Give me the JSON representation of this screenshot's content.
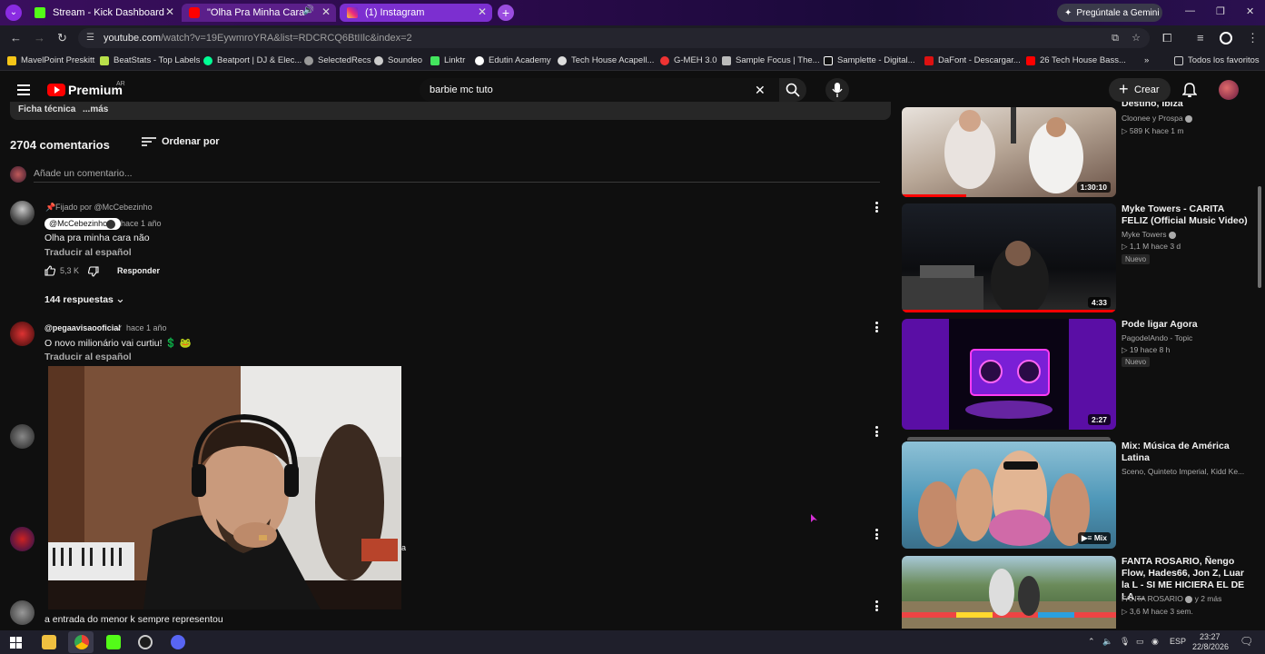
{
  "browser": {
    "tabs": [
      {
        "label": "Stream - Kick Dashboard"
      },
      {
        "label": "\"Olha Pra Minha Cara Não\""
      },
      {
        "label": "(1) Instagram"
      }
    ],
    "gemini_label": "Pregúntale a Gemini",
    "url_host": "youtube.com",
    "url_path": "/watch?v=19EywmroYRA&list=RDCRCQ6BtIIlc&index=2",
    "bookmarks": [
      "MavelPoint Preskitt",
      "BeatStats - Top Labels",
      "Beatport | DJ & Elec...",
      "SelectedRecs",
      "Soundeo",
      "Linktr",
      "Edutin Academy",
      "Tech House Acapell...",
      "G-MEH 3.0",
      "Sample Focus | The...",
      "Samplette - Digital...",
      "DaFont - Descargar...",
      "26 Tech House Bass..."
    ],
    "bookmarks_overflow": "»",
    "all_favorites": "Todos los favoritos"
  },
  "youtube": {
    "brand": "Premium",
    "region": "AR",
    "search_value": "barbie mc tuto",
    "create_label": "Crear"
  },
  "description_peek": {
    "left": "Ficha técnica",
    "right": "...más"
  },
  "comments": {
    "count_label": "2704 comentarios",
    "sort_label": "Ordenar por",
    "add_placeholder": "Añade un comentario...",
    "pinned_label": "Fijado por @McCebezinho",
    "items": [
      {
        "author": "@McCebezinho",
        "time": "hace 1 año",
        "text": "Olha pra minha cara não",
        "translate": "Traducir al español",
        "likes": "5,3 K",
        "reply": "Responder",
        "replies": "144 respuestas"
      },
      {
        "author": "@pegaavisaooficial",
        "time": "hace 1 año",
        "text": "O novo milionário vai curtiu! 💲 🐸",
        "translate": "Traducir al español"
      }
    ],
    "partial_text_1": "a",
    "bottom_text": "a entrada do menor k sempre representou"
  },
  "sidebar": {
    "videos": [
      {
        "title": "Destino, Ibiza",
        "channel": "Cloonee y Prospa",
        "stats": "589 K  hace 1 m",
        "duration": "1:30:10",
        "progress": 0.3
      },
      {
        "title": "Myke Towers - CARITA FELIZ (Official Music Video)",
        "channel": "Myke Towers",
        "stats": "1,1 M  hace 3 d",
        "badge": "Nuevo",
        "duration": "4:33",
        "progress": 1.0
      },
      {
        "title": "Pode ligar Agora",
        "channel": "PagodelAndo - Topic",
        "stats": "19  hace 8 h",
        "badge": "Nuevo",
        "duration": "2:27"
      },
      {
        "title": "Mix: Música de América Latina",
        "channel": "Sceno, Quinteto Imperial, Kidd Ke...",
        "duration": "Mix"
      },
      {
        "title": "FANTA ROSARIO, Ñengo Flow, Hades66, Jon Z,  Luar la L - SI ME HICIERA EL DE LA ...",
        "channel": "FANTA ROSARIO",
        "stats_inline": "y 2 más",
        "stats": "3,6 M  hace 3 sem."
      }
    ]
  },
  "taskbar": {
    "lang": "ESP",
    "time": "23:27",
    "date": "22/8/2026"
  },
  "colors": {
    "accent_red": "#ff0000",
    "tab_purple": "#7c2fd0",
    "bg": "#0f0f0f"
  }
}
